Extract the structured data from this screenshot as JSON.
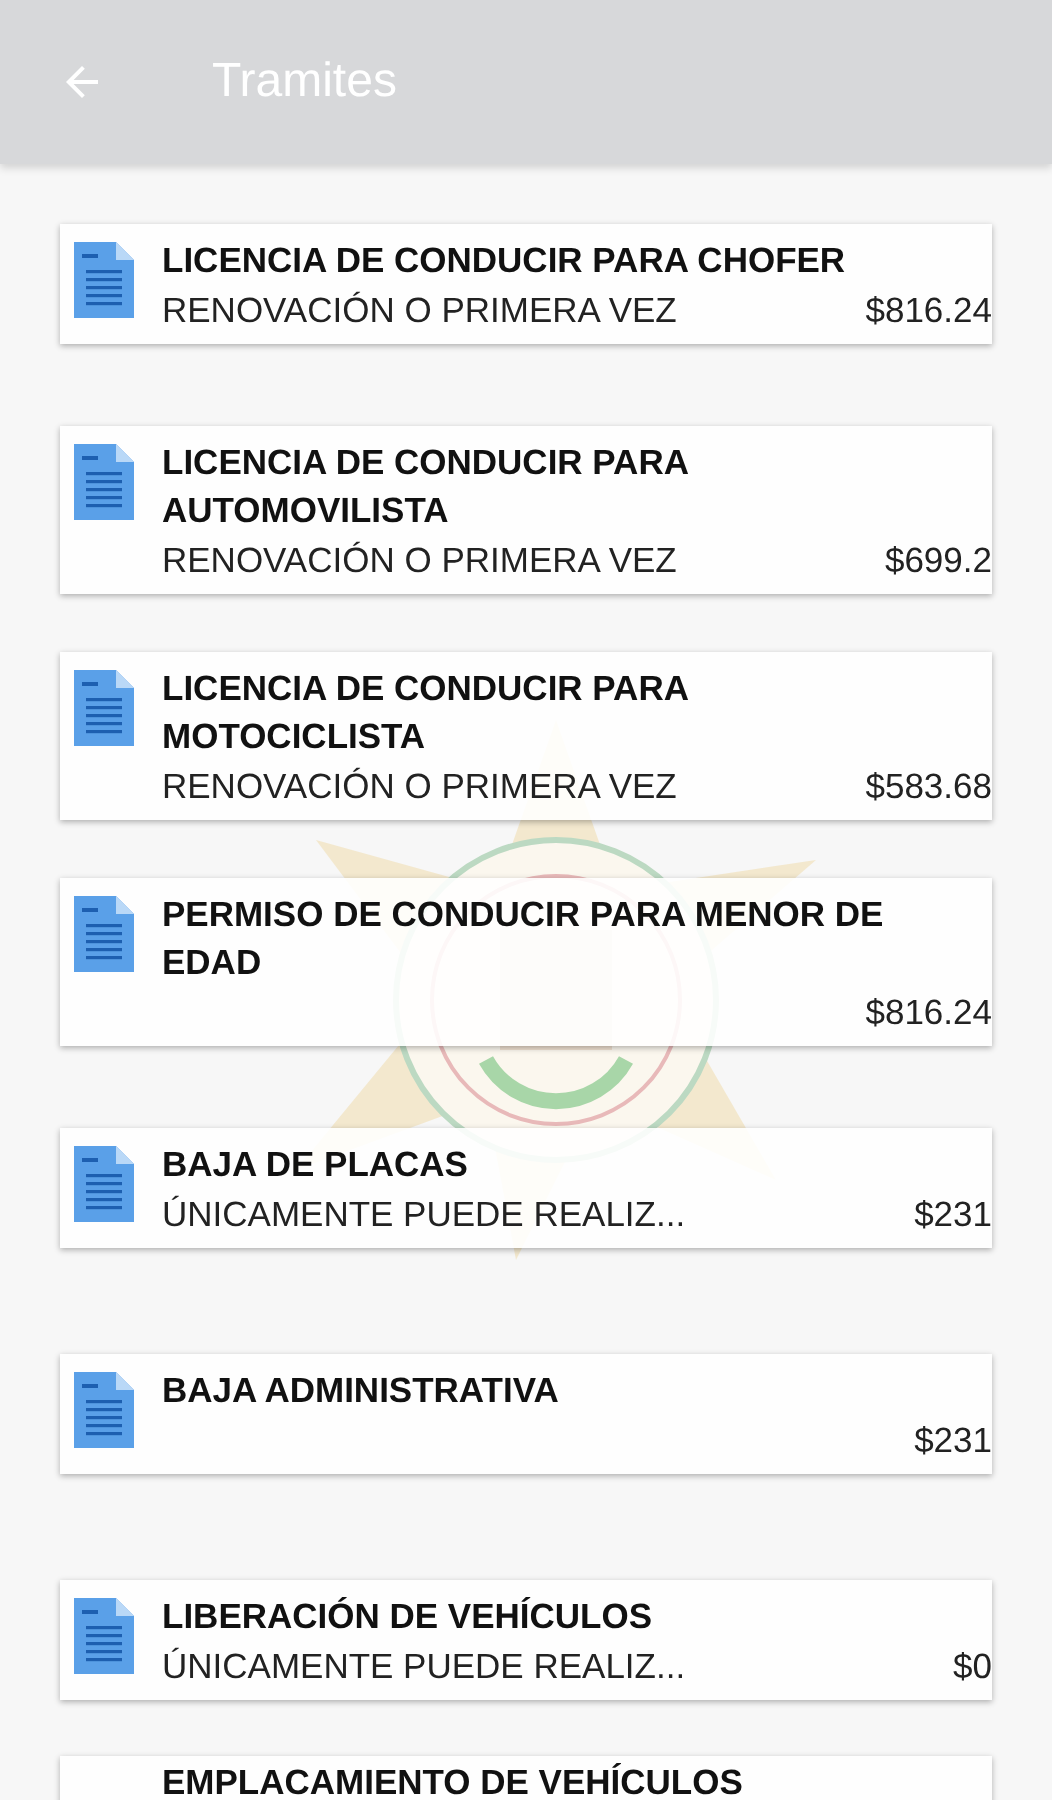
{
  "app_bar": {
    "title": "Tramites"
  },
  "items": [
    {
      "title": "LICENCIA DE CONDUCIR PARA CHOFER",
      "subtitle": "RENOVACIÓN O PRIMERA VEZ",
      "price": "$816.24"
    },
    {
      "title": "LICENCIA DE CONDUCIR PARA AUTOMOVILISTA",
      "subtitle": "RENOVACIÓN O PRIMERA VEZ",
      "price": "$699.2"
    },
    {
      "title": "LICENCIA DE CONDUCIR PARA MOTOCICLISTA",
      "subtitle": "RENOVACIÓN O PRIMERA VEZ",
      "price": "$583.68"
    },
    {
      "title": "PERMISO DE CONDUCIR PARA MENOR DE EDAD",
      "price": "$816.24"
    },
    {
      "title": "BAJA DE PLACAS",
      "subtitle": "ÚNICAMENTE PUEDE REALIZ...",
      "price": "$231"
    },
    {
      "title": "BAJA ADMINISTRATIVA",
      "price": "$231"
    },
    {
      "title": "LIBERACIÓN DE VEHÍCULOS",
      "subtitle": "ÚNICAMENTE PUEDE REALIZ...",
      "price": "$0"
    },
    {
      "title": "EMPLACAMIENTO DE VEHÍCULOS"
    }
  ]
}
